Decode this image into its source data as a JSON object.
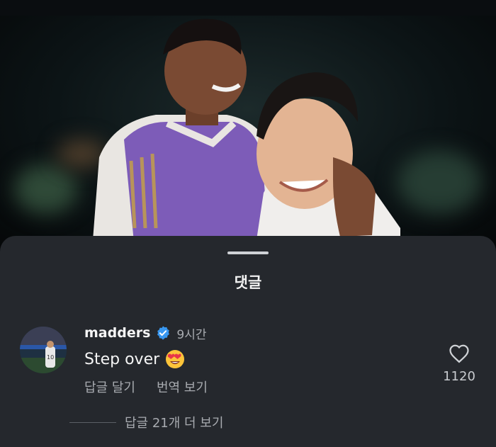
{
  "sheet": {
    "title": "댓글"
  },
  "comment": {
    "username": "madders",
    "verified": true,
    "time_ago": "9시간",
    "text": "Step over",
    "emoji": "heart-eyes",
    "actions": {
      "reply": "답글 달기",
      "translate": "번역 보기"
    },
    "likes": "1120",
    "more_replies": "답글 21개 더 보기"
  },
  "icons": {
    "verified_badge": "verified-check-icon",
    "like": "heart-outline-icon",
    "avatar_jersey_number": "10"
  },
  "colors": {
    "sheet_background": "#25282d",
    "verified_blue": "#3897f0",
    "secondary_text": "#a8abb0",
    "bib_purple": "#7d5cb8"
  }
}
